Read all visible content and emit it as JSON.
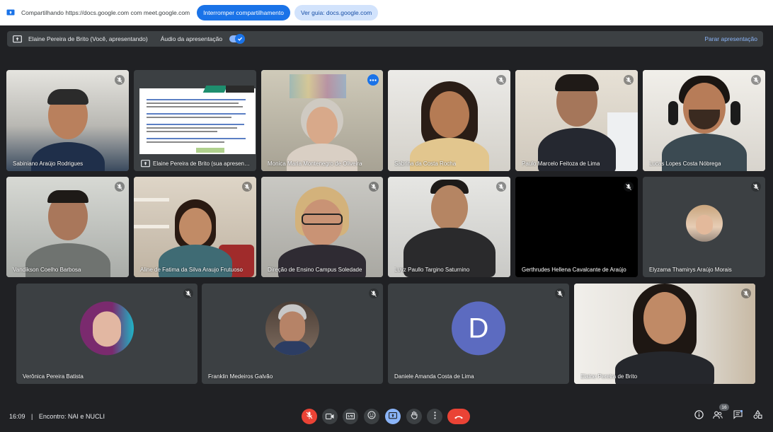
{
  "share_bar": {
    "text": "Compartilhando https://docs.google.com com meet.google.com",
    "stop_button": "Interromper compartilhamento",
    "view_tab_button": "Ver guia: docs.google.com"
  },
  "presenter_bar": {
    "presenter": "Elaine Pereira de Brito (Você, apresentando)",
    "audio_label": "Áudio da apresentação",
    "audio_on": true,
    "stop_label": "Parar apresentação"
  },
  "tiles": [
    {
      "name": "Sabiniano Araújo Rodrigues",
      "muted": true
    },
    {
      "name": "Elaine Pereira de Brito (sua apresentação)",
      "muted": false
    },
    {
      "name": "Monica Maria Montenegro de Oliveira",
      "muted": false
    },
    {
      "name": "Sabrina da Costa Rocha",
      "muted": true
    },
    {
      "name": "Paulo Marcelo Feitoza de Lima",
      "muted": true
    },
    {
      "name": "Lucas Lopes Costa Nóbrega",
      "muted": true
    },
    {
      "name": "Vandikson Coelho Barbosa",
      "muted": true
    },
    {
      "name": "Aline de Fatima da Silva Araujo Frutuoso",
      "muted": true
    },
    {
      "name": "Direção de Ensino Campus Soledade",
      "muted": true
    },
    {
      "name": "Luyz Paullo Targino Saturnino",
      "muted": true
    },
    {
      "name": "Gerthrudes Hellena Cavalcante de Araújo",
      "muted": true
    },
    {
      "name": "Elyzama Thamirys Araújo Morais",
      "muted": true
    },
    {
      "name": "Verônica Pereira Batista",
      "muted": true
    },
    {
      "name": "Franklin Medeiros Galvão",
      "muted": true
    },
    {
      "name": "Daniele Amanda Costa de Lima",
      "muted": true,
      "initial": "D"
    },
    {
      "name": "Elaine Pereira de Brito",
      "muted": true
    }
  ],
  "bottom": {
    "time": "16:09",
    "separator": "|",
    "meeting": "Encontro: NAI e NUCLI",
    "participants_count": "16"
  },
  "colors": {
    "background": "#202124",
    "tile": "#3c4043",
    "accent": "#1a73e8",
    "danger": "#ea4335",
    "highlight": "#8ab4f8"
  }
}
